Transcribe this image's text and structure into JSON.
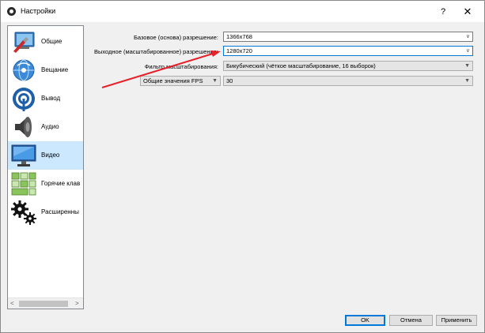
{
  "window": {
    "title": "Настройки"
  },
  "titlebar": {
    "help_label": "?",
    "close_label": "✕"
  },
  "sidebar": {
    "items": [
      {
        "label": "Общие",
        "icon": "general-settings-icon"
      },
      {
        "label": "Вещание",
        "icon": "broadcast-globe-icon"
      },
      {
        "label": "Вывод",
        "icon": "output-signal-icon"
      },
      {
        "label": "Аудио",
        "icon": "speaker-icon"
      },
      {
        "label": "Видео",
        "icon": "monitor-icon",
        "active": true
      },
      {
        "label": "Горячие клав",
        "icon": "keyboard-icon"
      },
      {
        "label": "Расширенны",
        "icon": "gears-icon"
      }
    ],
    "scroll_left": "<",
    "scroll_right": ">"
  },
  "video": {
    "base_resolution_label": "Базовое (основа) разрешение:",
    "base_resolution_value": "1366x768",
    "output_resolution_label": "Выходное (масштабированное) разрешение:",
    "output_resolution_value": "1280x720",
    "downscale_filter_label": "Фильтр масштабирования:",
    "downscale_filter_value": "Бикубический (чёткое масштабирование, 16 выборок)",
    "fps_type_value": "Общие значения FPS",
    "fps_value": "30"
  },
  "buttons": {
    "ok": "OK",
    "cancel": "Отмена",
    "apply": "Применить"
  },
  "colors": {
    "annotation_arrow": "#e8202a",
    "active_item": "#cce8ff",
    "focus_border": "#0078d7"
  }
}
